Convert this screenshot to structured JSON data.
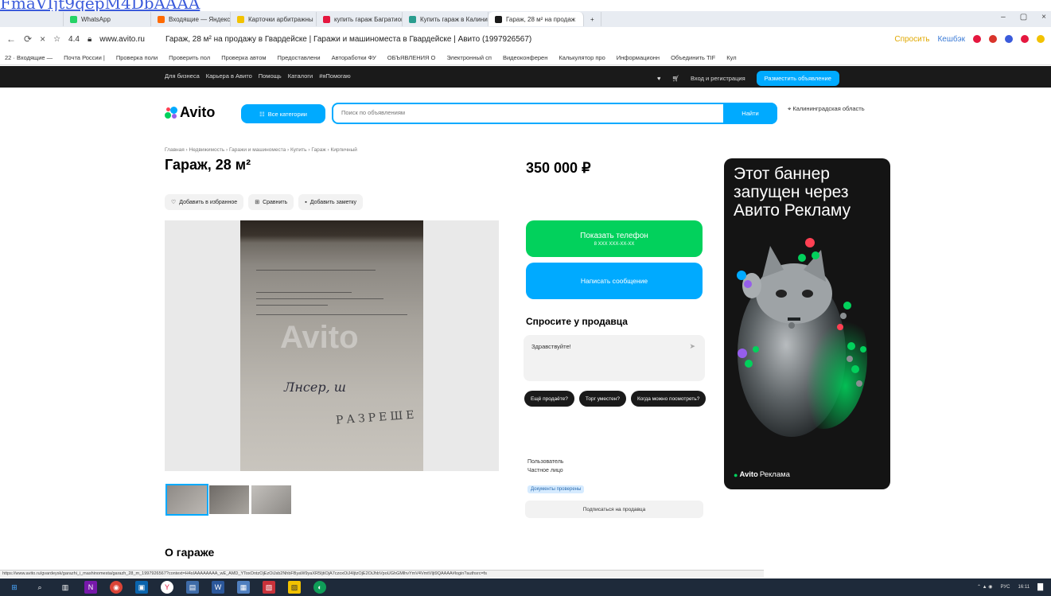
{
  "leaked_link": "FmaVIjt9qepM4DbAAAA",
  "browser": {
    "tabs": [
      {
        "label": "WhatsApp",
        "color": "#25d366"
      },
      {
        "label": "Входящие — Яндекс П",
        "color": "#ff6a00"
      },
      {
        "label": "Карточки арбитражны",
        "color": "#f2c200"
      },
      {
        "label": "купить гараж Багратион",
        "color": "#e5173f"
      },
      {
        "label": "Купить гараж в Калинин",
        "color": "#2a9d8f"
      },
      {
        "label": "Гараж, 28 м² на продаж",
        "color": "#1a1a1a"
      }
    ],
    "new_tab_label": "+",
    "window_controls": [
      "–",
      "▢",
      "×"
    ],
    "rating": "4.4",
    "domain": "www.avito.ru",
    "page_title": "Гараж, 28 м² на продажу в Гвардейске | Гаражи и машиноместа в Гвардейске | Авито (1997926567)",
    "ask_label": "Спросить",
    "cashback_label": "Кешбэк"
  },
  "bookmarks": [
    "22 · Входящие —",
    "Почта России |",
    "Проверка поли",
    "Проверить пол",
    "Проверка автом",
    "Предоставлени",
    "Автоработки ФУ",
    "ОБЪЯВЛЕНИЯ О",
    "Электронный сп",
    "Видеоконферен",
    "Калькулятор про",
    "Информационн",
    "Объединить TIF",
    "Кул"
  ],
  "avito_topbar": {
    "links": [
      "Для бизнеса",
      "Карьера в Авито",
      "Помощь",
      "Каталоги",
      "#яПомогаю"
    ],
    "login": "Вход и регистрация",
    "post_ad": "Разместить объявление"
  },
  "header": {
    "logo": "Avito",
    "categories_button": "Все категории",
    "search_placeholder": "Поиск по объявлениям",
    "search_button": "Найти",
    "region": "Калининградская область"
  },
  "breadcrumbs": "Главная › Недвижимость › Гаражи и машиноместа › Купить › Гараж › Кирпичный",
  "listing": {
    "title": "Гараж, 28 м²",
    "price": "350 000 ₽",
    "add_favorite": "Добавить в избранное",
    "compare": "Сравнить",
    "add_note": "Добавить заметку",
    "photo_watermark": "Avito",
    "photo_stamp": "РАЗРЕШЕ",
    "photo_signature": "Лнсер, ш"
  },
  "contact": {
    "show_phone": "Показать телефон",
    "phone_masked": "8 XXX XXX-XX-XX",
    "write_message": "Написать сообщение",
    "ask_seller_title": "Спросите у продавца",
    "ask_input_value": "Здравствуйте!",
    "chips": [
      "Ещё продаёте?",
      "Торг уместен?",
      "Когда можно посмотреть?"
    ],
    "seller_label": "Пользователь",
    "seller_type": "Частное лицо",
    "verified_badge": "Документы проверены",
    "subscribe": "Подписаться на продавца"
  },
  "banner": {
    "text": "Этот баннер запущен через Авито Рекламу",
    "footer_brand": "Avito",
    "footer_word": "Реклама"
  },
  "section_about": "О гараже",
  "status_url": "https://www.avito.ru/gvardeysk/garazhi_i_mashinomesta/garazh_28_m_1997926567?context=H4sIAAAAAAAA_wE_AMD_YToxOntzOjEzOiJsb2NhbFByaW9yaXR5IjtiOjA7czoxOiJ4IjtzOjE2OiJhbVpoUGhGMlhvYmV4VmtVIjt9QAAAA#login?authsrc=fs",
  "taskbar": {
    "apps": [
      "⊞",
      "⌕",
      "▥",
      "N",
      "◉",
      "▣",
      "Y",
      "▤",
      "W",
      "▦",
      "▧",
      "▨",
      "◐"
    ],
    "lang": "РУС",
    "time": "16:11"
  },
  "colors": {
    "accent": "#00aaff",
    "green": "#02d15c",
    "dark": "#1a1a1a"
  }
}
